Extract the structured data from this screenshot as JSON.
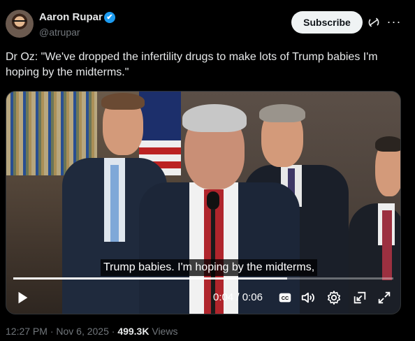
{
  "author": {
    "name": "Aaron Rupar",
    "handle": "@atrupar",
    "verified_mark": "✔"
  },
  "header": {
    "subscribe_label": "Subscribe",
    "more_label": "···"
  },
  "tweet": {
    "text": "Dr Oz: \"We've dropped the infertility drugs to make lots of Trump babies I'm hoping by the midterms.\""
  },
  "video": {
    "caption": "Trump babies. I'm hoping by the midterms,",
    "current_time": "0:04",
    "separator": " / ",
    "duration": "0:06",
    "progress_fraction": 0.72,
    "icons": [
      "play-icon",
      "closed-captions-icon",
      "volume-icon",
      "settings-icon",
      "picture-in-picture-icon",
      "fullscreen-icon"
    ]
  },
  "footer": {
    "time": "12:27 PM · Nov 6, 2025 · ",
    "views_count": "499.3K",
    "views_label": " Views"
  },
  "colors": {
    "background": "#000000",
    "text_primary": "#e7e9ea",
    "text_secondary": "#71767b",
    "verified": "#1d9bf0",
    "button_bg": "#eff3f4"
  }
}
